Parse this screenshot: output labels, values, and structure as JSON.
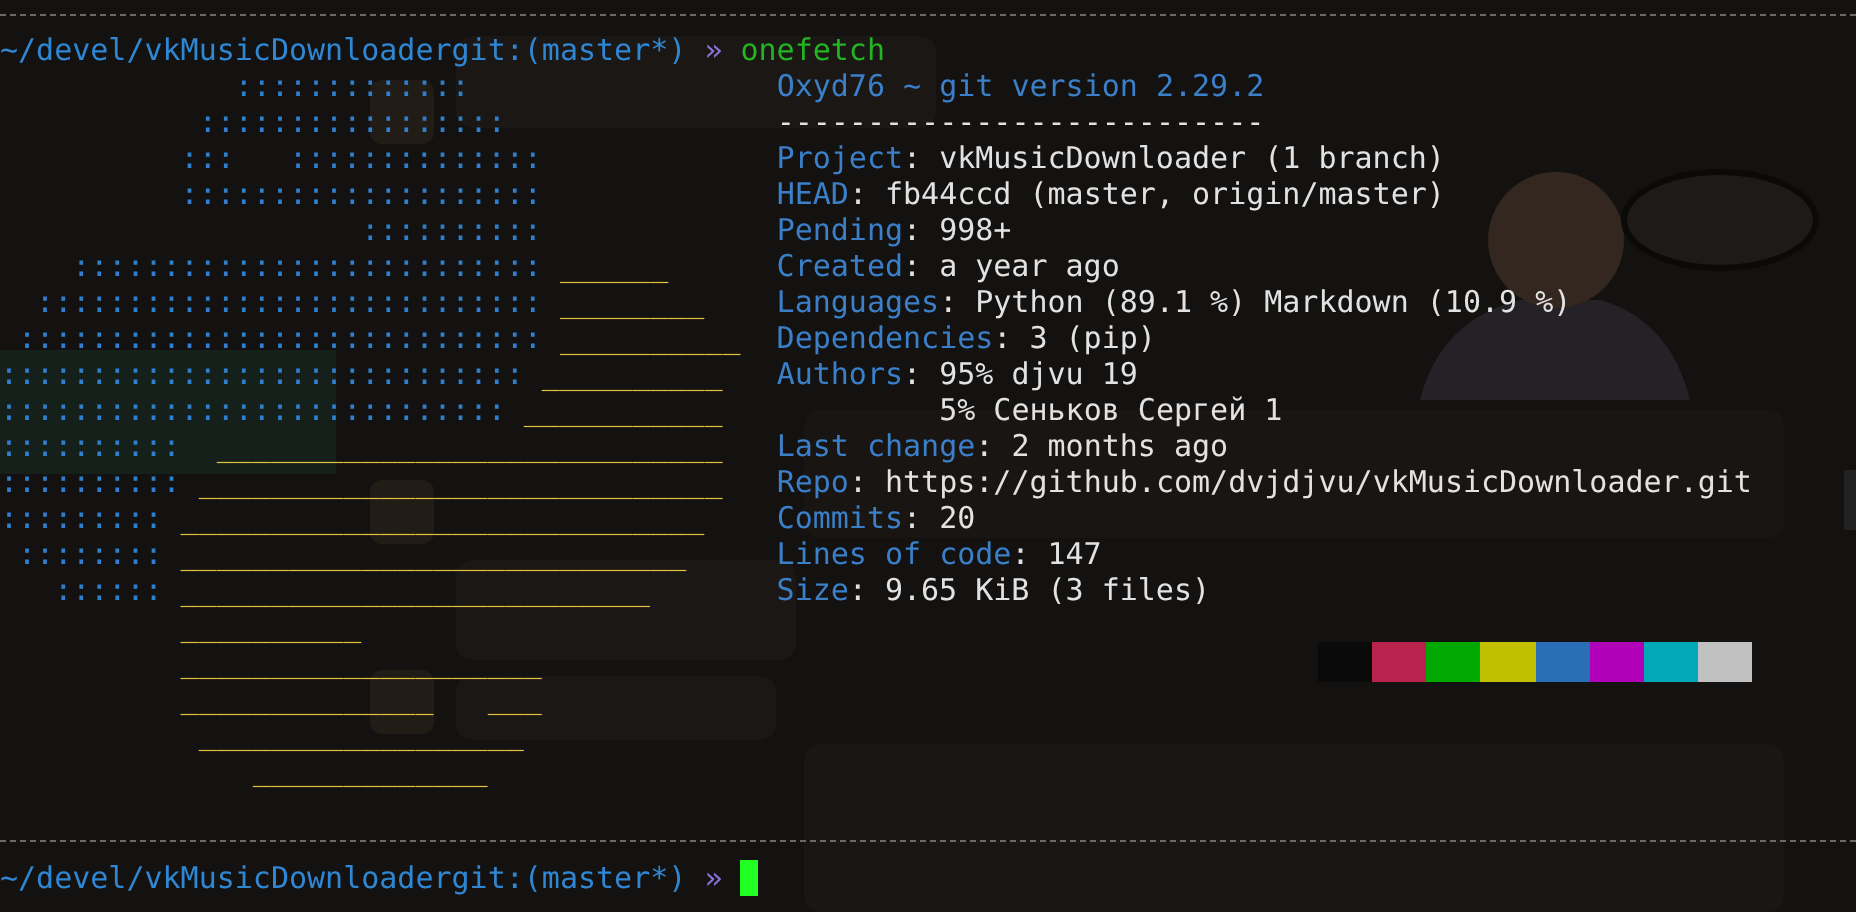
{
  "terminal": {
    "prompt": {
      "path": "~/devel/vkMusicDownloadergit:(master*)",
      "arrow": "»",
      "command": "onefetch"
    },
    "title": "Oxyd76 ~ git version 2.29.2",
    "rule": "---------------------------",
    "fields": [
      {
        "label": "Project:",
        "values": [
          "vkMusicDownloader (1 branch)"
        ]
      },
      {
        "label": "HEAD:",
        "values": [
          "fb44ccd (master, origin/master)"
        ]
      },
      {
        "label": "Pending:",
        "values": [
          "998+"
        ]
      },
      {
        "label": "Created:",
        "values": [
          "a year ago"
        ]
      },
      {
        "label": "Languages:",
        "values": [
          "Python (89.1 %) Markdown (10.9 %)"
        ]
      },
      {
        "label": "Dependencies:",
        "values": [
          "3 (pip)"
        ]
      },
      {
        "label": "Authors:",
        "values": [
          "95% djvu 19",
          "5% Сеньков Сергей 1"
        ]
      },
      {
        "label": "Last change:",
        "values": [
          "2 months ago"
        ]
      },
      {
        "label": "Repo:",
        "values": [
          "https://github.com/dvjdjvu/vkMusicDownloader.git"
        ]
      },
      {
        "label": "Commits:",
        "values": [
          "20"
        ]
      },
      {
        "label": "Lines of code:",
        "values": [
          "147"
        ]
      },
      {
        "label": "Size:",
        "values": [
          "9.65 KiB (3 files)"
        ]
      }
    ],
    "palette": [
      {
        "color": "#0a0a0a"
      },
      {
        "color": "#b8224c"
      },
      {
        "color": "#00a800"
      },
      {
        "color": "#c0c000"
      },
      {
        "color": "#2a6fb5"
      },
      {
        "color": "#b000b8"
      },
      {
        "color": "#00a8b8"
      },
      {
        "color": "#c0c0c0"
      }
    ],
    "logo": [
      [
        {
          "kind": "dots",
          "text": ":::::::::::::"
        }
      ],
      [
        {
          "kind": "dots",
          "text": ":::::::::::::::::"
        }
      ],
      [
        {
          "kind": "dots",
          "text": ":::"
        },
        {
          "kind": "dots",
          "text": "::::::::::::::"
        }
      ],
      [
        {
          "kind": "dots",
          "text": "::::::::::::::::::::"
        }
      ],
      [
        {
          "kind": "dots",
          "text": "::::::::::"
        }
      ],
      [
        {
          "kind": "dots",
          "text": "::::::::::::::::::::::::::"
        },
        {
          "kind": "bar",
          "text": "______"
        }
      ],
      [
        {
          "kind": "dots",
          "text": "::::::::::::::::::::::::::::"
        },
        {
          "kind": "bar",
          "text": "________"
        }
      ],
      [
        {
          "kind": "dots",
          "text": ":::::::::::::::::::::::::::::"
        },
        {
          "kind": "bar",
          "text": "__________"
        }
      ],
      [
        {
          "kind": "dots",
          "text": ":::::::::::::::::::::::::::::"
        },
        {
          "kind": "bar",
          "text": "__________"
        }
      ],
      [
        {
          "kind": "dots",
          "text": "::::::::::::::::::::::::::::"
        },
        {
          "kind": "bar",
          "text": "___________"
        }
      ],
      [
        {
          "kind": "dots",
          "text": "::::::::::"
        },
        {
          "kind": "bar",
          "text": "____________________________"
        }
      ],
      [
        {
          "kind": "dots",
          "text": "::::::::::"
        },
        {
          "kind": "bar",
          "text": "_____________________________"
        }
      ],
      [
        {
          "kind": "dots",
          "text": ":::::::::"
        },
        {
          "kind": "bar",
          "text": "_____________________________"
        }
      ],
      [
        {
          "kind": "dots",
          "text": "::::::::"
        },
        {
          "kind": "bar",
          "text": "____________________________"
        }
      ],
      [
        {
          "kind": "dots",
          "text": "::::::"
        },
        {
          "kind": "bar",
          "text": "__________________________"
        }
      ],
      [
        {
          "kind": "bar",
          "text": "__________"
        }
      ],
      [
        {
          "kind": "bar",
          "text": "____________________"
        }
      ],
      [
        {
          "kind": "bar",
          "text": "______________"
        },
        {
          "kind": "bar",
          "text": "___"
        }
      ],
      [
        {
          "kind": "bar",
          "text": "__________________"
        }
      ],
      [
        {
          "kind": "bar",
          "text": "_____________"
        }
      ]
    ],
    "bottom_prompt": {
      "path": "~/devel/vkMusicDownloadergit:(master*)",
      "arrow": "»"
    }
  }
}
